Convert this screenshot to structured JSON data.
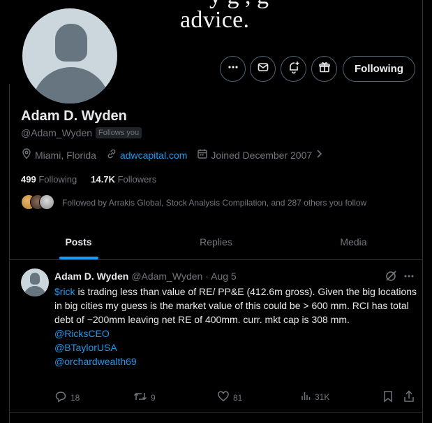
{
  "banner": {
    "text": "advice.",
    "partial_top": "y g      ,        g"
  },
  "profile": {
    "name": "Adam D. Wyden",
    "handle": "@Adam_Wyden",
    "follows_you": "Follows you",
    "location": "Miami, Florida",
    "website": "adwcapital.com",
    "joined": "Joined December 2007",
    "following_count": "499",
    "following_label": "Following",
    "followers_count": "14.7K",
    "followers_label": "Followers",
    "followed_by": "Followed by Arrakis Global, Stock Analysis Compilation, and 287 others you follow"
  },
  "actions": {
    "following_button": "Following",
    "icons": [
      "more-icon",
      "message-icon",
      "notify-icon",
      "gift-icon"
    ]
  },
  "tabs": [
    {
      "label": "Posts",
      "active": true
    },
    {
      "label": "Replies",
      "active": false
    },
    {
      "label": "Media",
      "active": false
    }
  ],
  "tweet": {
    "name": "Adam D. Wyden",
    "handle": "@Adam_Wyden",
    "date": "· Aug 5",
    "cashtag": "$rick",
    "text": " is trading less than value of RE/ PP&E (412.6m gross). Given the big locations in big cities my guess is the market value of this could be > 600 mm. RCI has total debt of ~200mm leaving net RE of 400mm. curr. mkt cap is 308 mm.",
    "mentions": [
      "@RicksCEO",
      "@BTaylorUSA",
      "@orchardwealth69"
    ],
    "replies": "18",
    "reposts": "9",
    "likes": "81",
    "views": "31K"
  },
  "colors": {
    "accent": "#1d9bf0",
    "muted": "#71767b",
    "text": "#e7e9ea",
    "bg": "#000000",
    "border": "#2f3336"
  }
}
